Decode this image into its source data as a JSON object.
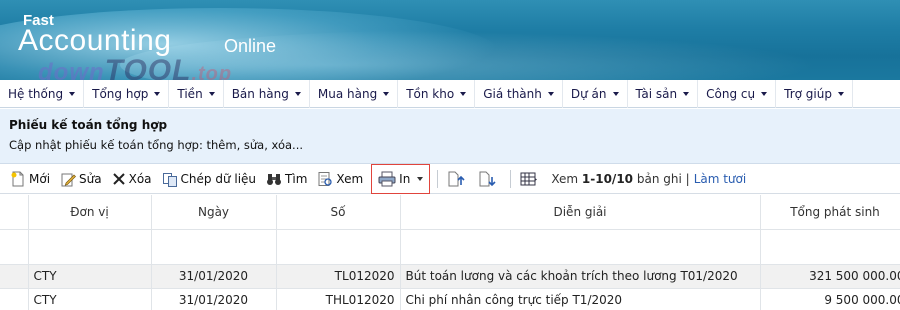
{
  "banner": {
    "brand_top": "Fast",
    "brand_main": "Accounting",
    "brand_suffix": "Online",
    "watermark_a": "down",
    "watermark_b": "TOOL",
    "watermark_c": ".top"
  },
  "menu": [
    {
      "label": "Hệ thống"
    },
    {
      "label": "Tổng hợp"
    },
    {
      "label": "Tiền"
    },
    {
      "label": "Bán hàng"
    },
    {
      "label": "Mua hàng"
    },
    {
      "label": "Tồn kho"
    },
    {
      "label": "Giá thành"
    },
    {
      "label": "Dự án"
    },
    {
      "label": "Tài sản"
    },
    {
      "label": "Công cụ"
    },
    {
      "label": "Trợ giúp"
    }
  ],
  "page": {
    "title": "Phiếu kế toán tổng hợp",
    "subtitle": "Cập nhật phiếu kế toán tổng hợp: thêm, sửa, xóa..."
  },
  "toolbar": {
    "new_label": "Mới",
    "edit_label": "Sửa",
    "delete_label": "Xóa",
    "copy_label": "Chép dữ liệu",
    "find_label": "Tìm",
    "view_label": "Xem",
    "print_label": "In",
    "record_prefix": "Xem",
    "record_range": "1-10/10",
    "record_suffix": "bản ghi",
    "record_separator": "|",
    "refresh_label": "Làm tươi"
  },
  "grid": {
    "columns": [
      "Đơn vị",
      "Ngày",
      "Số",
      "Diễn giải",
      "Tổng phát sinh"
    ],
    "rows": [
      {
        "unit": "CTY",
        "date": "31/01/2020",
        "number": "TL012020",
        "description": "Bút toán lương và các khoản trích theo lương T01/2020",
        "total": "321 500 000.00"
      },
      {
        "unit": "CTY",
        "date": "31/01/2020",
        "number": "THL012020",
        "description": "Chi phí nhân công trực tiếp T1/2020",
        "total": "9 500 000.00"
      }
    ]
  },
  "colors": {
    "menu_text": "#1a1a4a",
    "header_bg": "#e7f1fb",
    "print_highlight": "#e0443c",
    "link": "#2a5db0"
  }
}
